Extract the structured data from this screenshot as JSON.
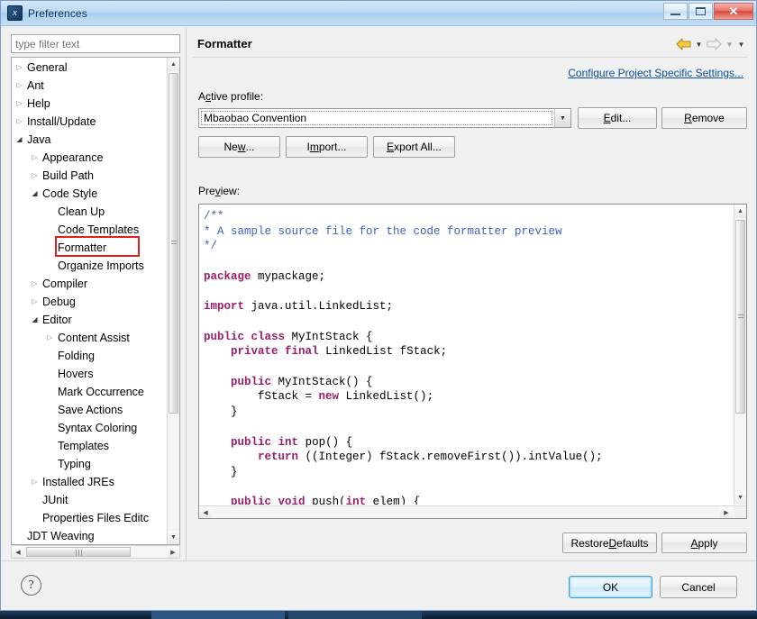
{
  "window": {
    "title": "Preferences",
    "app_icon": "eclipse-icon",
    "minimize_label": "Minimize",
    "maximize_label": "Maximize",
    "close_label": "Close"
  },
  "sidebar": {
    "filter": {
      "placeholder": "type filter text",
      "value": ""
    },
    "items": [
      {
        "label": "General",
        "indent": 0,
        "arrow": "collapsed"
      },
      {
        "label": "Ant",
        "indent": 0,
        "arrow": "collapsed"
      },
      {
        "label": "Help",
        "indent": 0,
        "arrow": "collapsed"
      },
      {
        "label": "Install/Update",
        "indent": 0,
        "arrow": "collapsed"
      },
      {
        "label": "Java",
        "indent": 0,
        "arrow": "expanded"
      },
      {
        "label": "Appearance",
        "indent": 1,
        "arrow": "collapsed"
      },
      {
        "label": "Build Path",
        "indent": 1,
        "arrow": "collapsed"
      },
      {
        "label": "Code Style",
        "indent": 1,
        "arrow": "expanded"
      },
      {
        "label": "Clean Up",
        "indent": 2,
        "arrow": "none"
      },
      {
        "label": "Code Templates",
        "indent": 2,
        "arrow": "none"
      },
      {
        "label": "Formatter",
        "indent": 2,
        "arrow": "none",
        "selected": true,
        "annotated": true
      },
      {
        "label": "Organize Imports",
        "indent": 2,
        "arrow": "none"
      },
      {
        "label": "Compiler",
        "indent": 1,
        "arrow": "collapsed"
      },
      {
        "label": "Debug",
        "indent": 1,
        "arrow": "collapsed"
      },
      {
        "label": "Editor",
        "indent": 1,
        "arrow": "expanded"
      },
      {
        "label": "Content Assist",
        "indent": 2,
        "arrow": "collapsed"
      },
      {
        "label": "Folding",
        "indent": 2,
        "arrow": "none"
      },
      {
        "label": "Hovers",
        "indent": 2,
        "arrow": "none"
      },
      {
        "label": "Mark Occurrence",
        "indent": 2,
        "arrow": "none"
      },
      {
        "label": "Save Actions",
        "indent": 2,
        "arrow": "none"
      },
      {
        "label": "Syntax Coloring",
        "indent": 2,
        "arrow": "none"
      },
      {
        "label": "Templates",
        "indent": 2,
        "arrow": "none"
      },
      {
        "label": "Typing",
        "indent": 2,
        "arrow": "none"
      },
      {
        "label": "Installed JREs",
        "indent": 1,
        "arrow": "collapsed"
      },
      {
        "label": "JUnit",
        "indent": 1,
        "arrow": "none"
      },
      {
        "label": "Properties Files Editc",
        "indent": 1,
        "arrow": "none"
      },
      {
        "label": "JDT Weaving",
        "indent": 0,
        "arrow": "none"
      }
    ]
  },
  "header": {
    "page_title": "Formatter",
    "back_icon": "back-arrow-icon",
    "forward_icon": "forward-arrow-icon",
    "project_link": "Configure Project Specific Settings..."
  },
  "main": {
    "active_profile_label_pre": "A",
    "active_profile_label_mn": "c",
    "active_profile_label_post": "tive profile:",
    "profile_value": "Mbaobao Convention",
    "preview_label_pre": "Pre",
    "preview_label_mn": "v",
    "preview_label_post": "iew:",
    "buttons": {
      "edit": {
        "pre": "",
        "mn": "E",
        "post": "dit..."
      },
      "remove": {
        "pre": "",
        "mn": "R",
        "post": "emove"
      },
      "new": {
        "pre": "Ne",
        "mn": "w",
        "post": "..."
      },
      "import": {
        "pre": "I",
        "mn": "m",
        "post": "port..."
      },
      "export_all": {
        "pre": "",
        "mn": "E",
        "post": "xport All..."
      },
      "restore_defaults": {
        "pre": "Restore ",
        "mn": "D",
        "post": "efaults"
      },
      "apply": {
        "pre": "",
        "mn": "A",
        "post": "pply"
      }
    }
  },
  "preview_code": {
    "language": "java",
    "lines": [
      [
        {
          "t": "/**",
          "s": "c"
        }
      ],
      [
        {
          "t": "* A sample source file for the code formatter preview",
          "s": "c"
        }
      ],
      [
        {
          "t": "*/",
          "s": "c"
        }
      ],
      [
        {
          "t": "",
          "s": ""
        }
      ],
      [
        {
          "t": "package",
          "s": "k"
        },
        {
          "t": " mypackage;",
          "s": ""
        }
      ],
      [
        {
          "t": "",
          "s": ""
        }
      ],
      [
        {
          "t": "import",
          "s": "k"
        },
        {
          "t": " java.util.LinkedList;",
          "s": ""
        }
      ],
      [
        {
          "t": "",
          "s": ""
        }
      ],
      [
        {
          "t": "public",
          "s": "k"
        },
        {
          "t": " ",
          "s": ""
        },
        {
          "t": "class",
          "s": "k"
        },
        {
          "t": " MyIntStack {",
          "s": ""
        }
      ],
      [
        {
          "t": "    ",
          "s": ""
        },
        {
          "t": "private",
          "s": "k"
        },
        {
          "t": " ",
          "s": ""
        },
        {
          "t": "final",
          "s": "k"
        },
        {
          "t": " LinkedList fStack;",
          "s": ""
        }
      ],
      [
        {
          "t": "",
          "s": ""
        }
      ],
      [
        {
          "t": "    ",
          "s": ""
        },
        {
          "t": "public",
          "s": "k"
        },
        {
          "t": " MyIntStack() {",
          "s": ""
        }
      ],
      [
        {
          "t": "        fStack = ",
          "s": ""
        },
        {
          "t": "new",
          "s": "k"
        },
        {
          "t": " LinkedList();",
          "s": ""
        }
      ],
      [
        {
          "t": "    }",
          "s": ""
        }
      ],
      [
        {
          "t": "",
          "s": ""
        }
      ],
      [
        {
          "t": "    ",
          "s": ""
        },
        {
          "t": "public",
          "s": "k"
        },
        {
          "t": " ",
          "s": ""
        },
        {
          "t": "int",
          "s": "k"
        },
        {
          "t": " pop() {",
          "s": ""
        }
      ],
      [
        {
          "t": "        ",
          "s": ""
        },
        {
          "t": "return",
          "s": "k"
        },
        {
          "t": " ((Integer) fStack.removeFirst()).intValue();",
          "s": ""
        }
      ],
      [
        {
          "t": "    }",
          "s": ""
        }
      ],
      [
        {
          "t": "",
          "s": ""
        }
      ],
      [
        {
          "t": "    ",
          "s": ""
        },
        {
          "t": "public",
          "s": "k"
        },
        {
          "t": " ",
          "s": ""
        },
        {
          "t": "void",
          "s": "k"
        },
        {
          "t": " push(",
          "s": ""
        },
        {
          "t": "int",
          "s": "k"
        },
        {
          "t": " elem) {",
          "s": ""
        }
      ]
    ]
  },
  "footer": {
    "help_icon": "help-question-icon",
    "ok": "OK",
    "cancel": "Cancel"
  },
  "colors": {
    "accent": "#0b4f9e",
    "annotation": "#e02020",
    "keyword": "#9b1d6b",
    "comment": "#3f5fbf",
    "titlebar": "#bcd9f2",
    "default_button": "#cde9f8"
  }
}
